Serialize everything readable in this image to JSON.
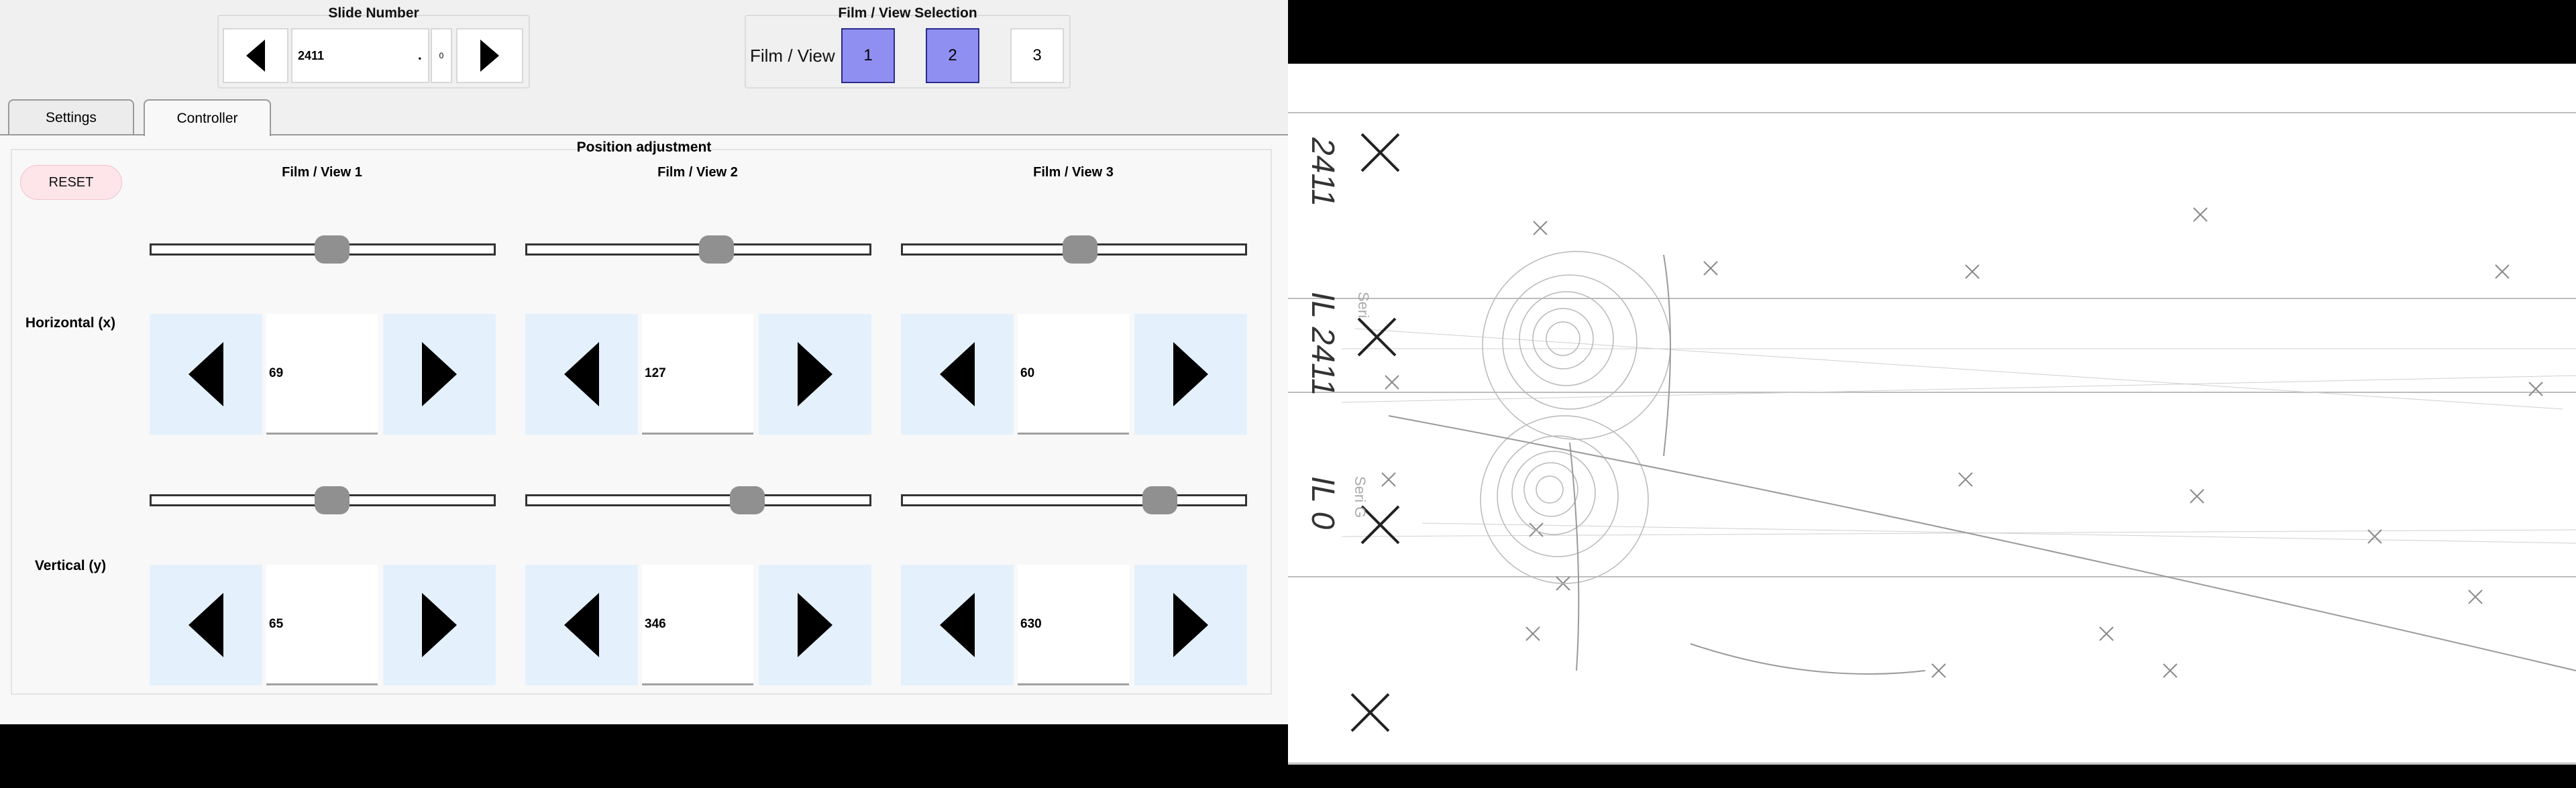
{
  "slide_number": {
    "title": "Slide Number",
    "value": "2411",
    "sub_value": "0",
    "prev_icon": "triangle-left-icon",
    "next_icon": "triangle-right-icon"
  },
  "film_view_selection": {
    "title": "Film / View Selection",
    "label": "Film / View",
    "buttons": [
      {
        "label": "1",
        "selected": true
      },
      {
        "label": "2",
        "selected": true
      },
      {
        "label": "3",
        "selected": false
      }
    ],
    "selected_color": "#8f8ff2"
  },
  "tabs": [
    {
      "label": "Settings",
      "active": false
    },
    {
      "label": "Controller",
      "active": true
    }
  ],
  "controller": {
    "group_title": "Position adjustment",
    "reset_label": "RESET",
    "reset_color": "#fde5ea",
    "row_labels": {
      "horizontal": "Horizontal (x)",
      "vertical": "Vertical (y)"
    },
    "views": [
      {
        "title": "Film / View 1",
        "x": "69",
        "y": "65",
        "x_slider_fraction": 0.53,
        "y_slider_fraction": 0.53
      },
      {
        "title": "Film / View 2",
        "x": "127",
        "y": "346",
        "x_slider_fraction": 0.56,
        "y_slider_fraction": 0.66
      },
      {
        "title": "Film / View 3",
        "x": "60",
        "y": "630",
        "x_slider_fraction": 0.52,
        "y_slider_fraction": 0.78
      }
    ],
    "arrow_button_color": "#e4f1fc"
  },
  "film_image": {
    "frame_labels": [
      "2411",
      "IL 2411",
      "IL 0"
    ],
    "series_labels": [
      "Seri",
      "Seri G"
    ]
  }
}
